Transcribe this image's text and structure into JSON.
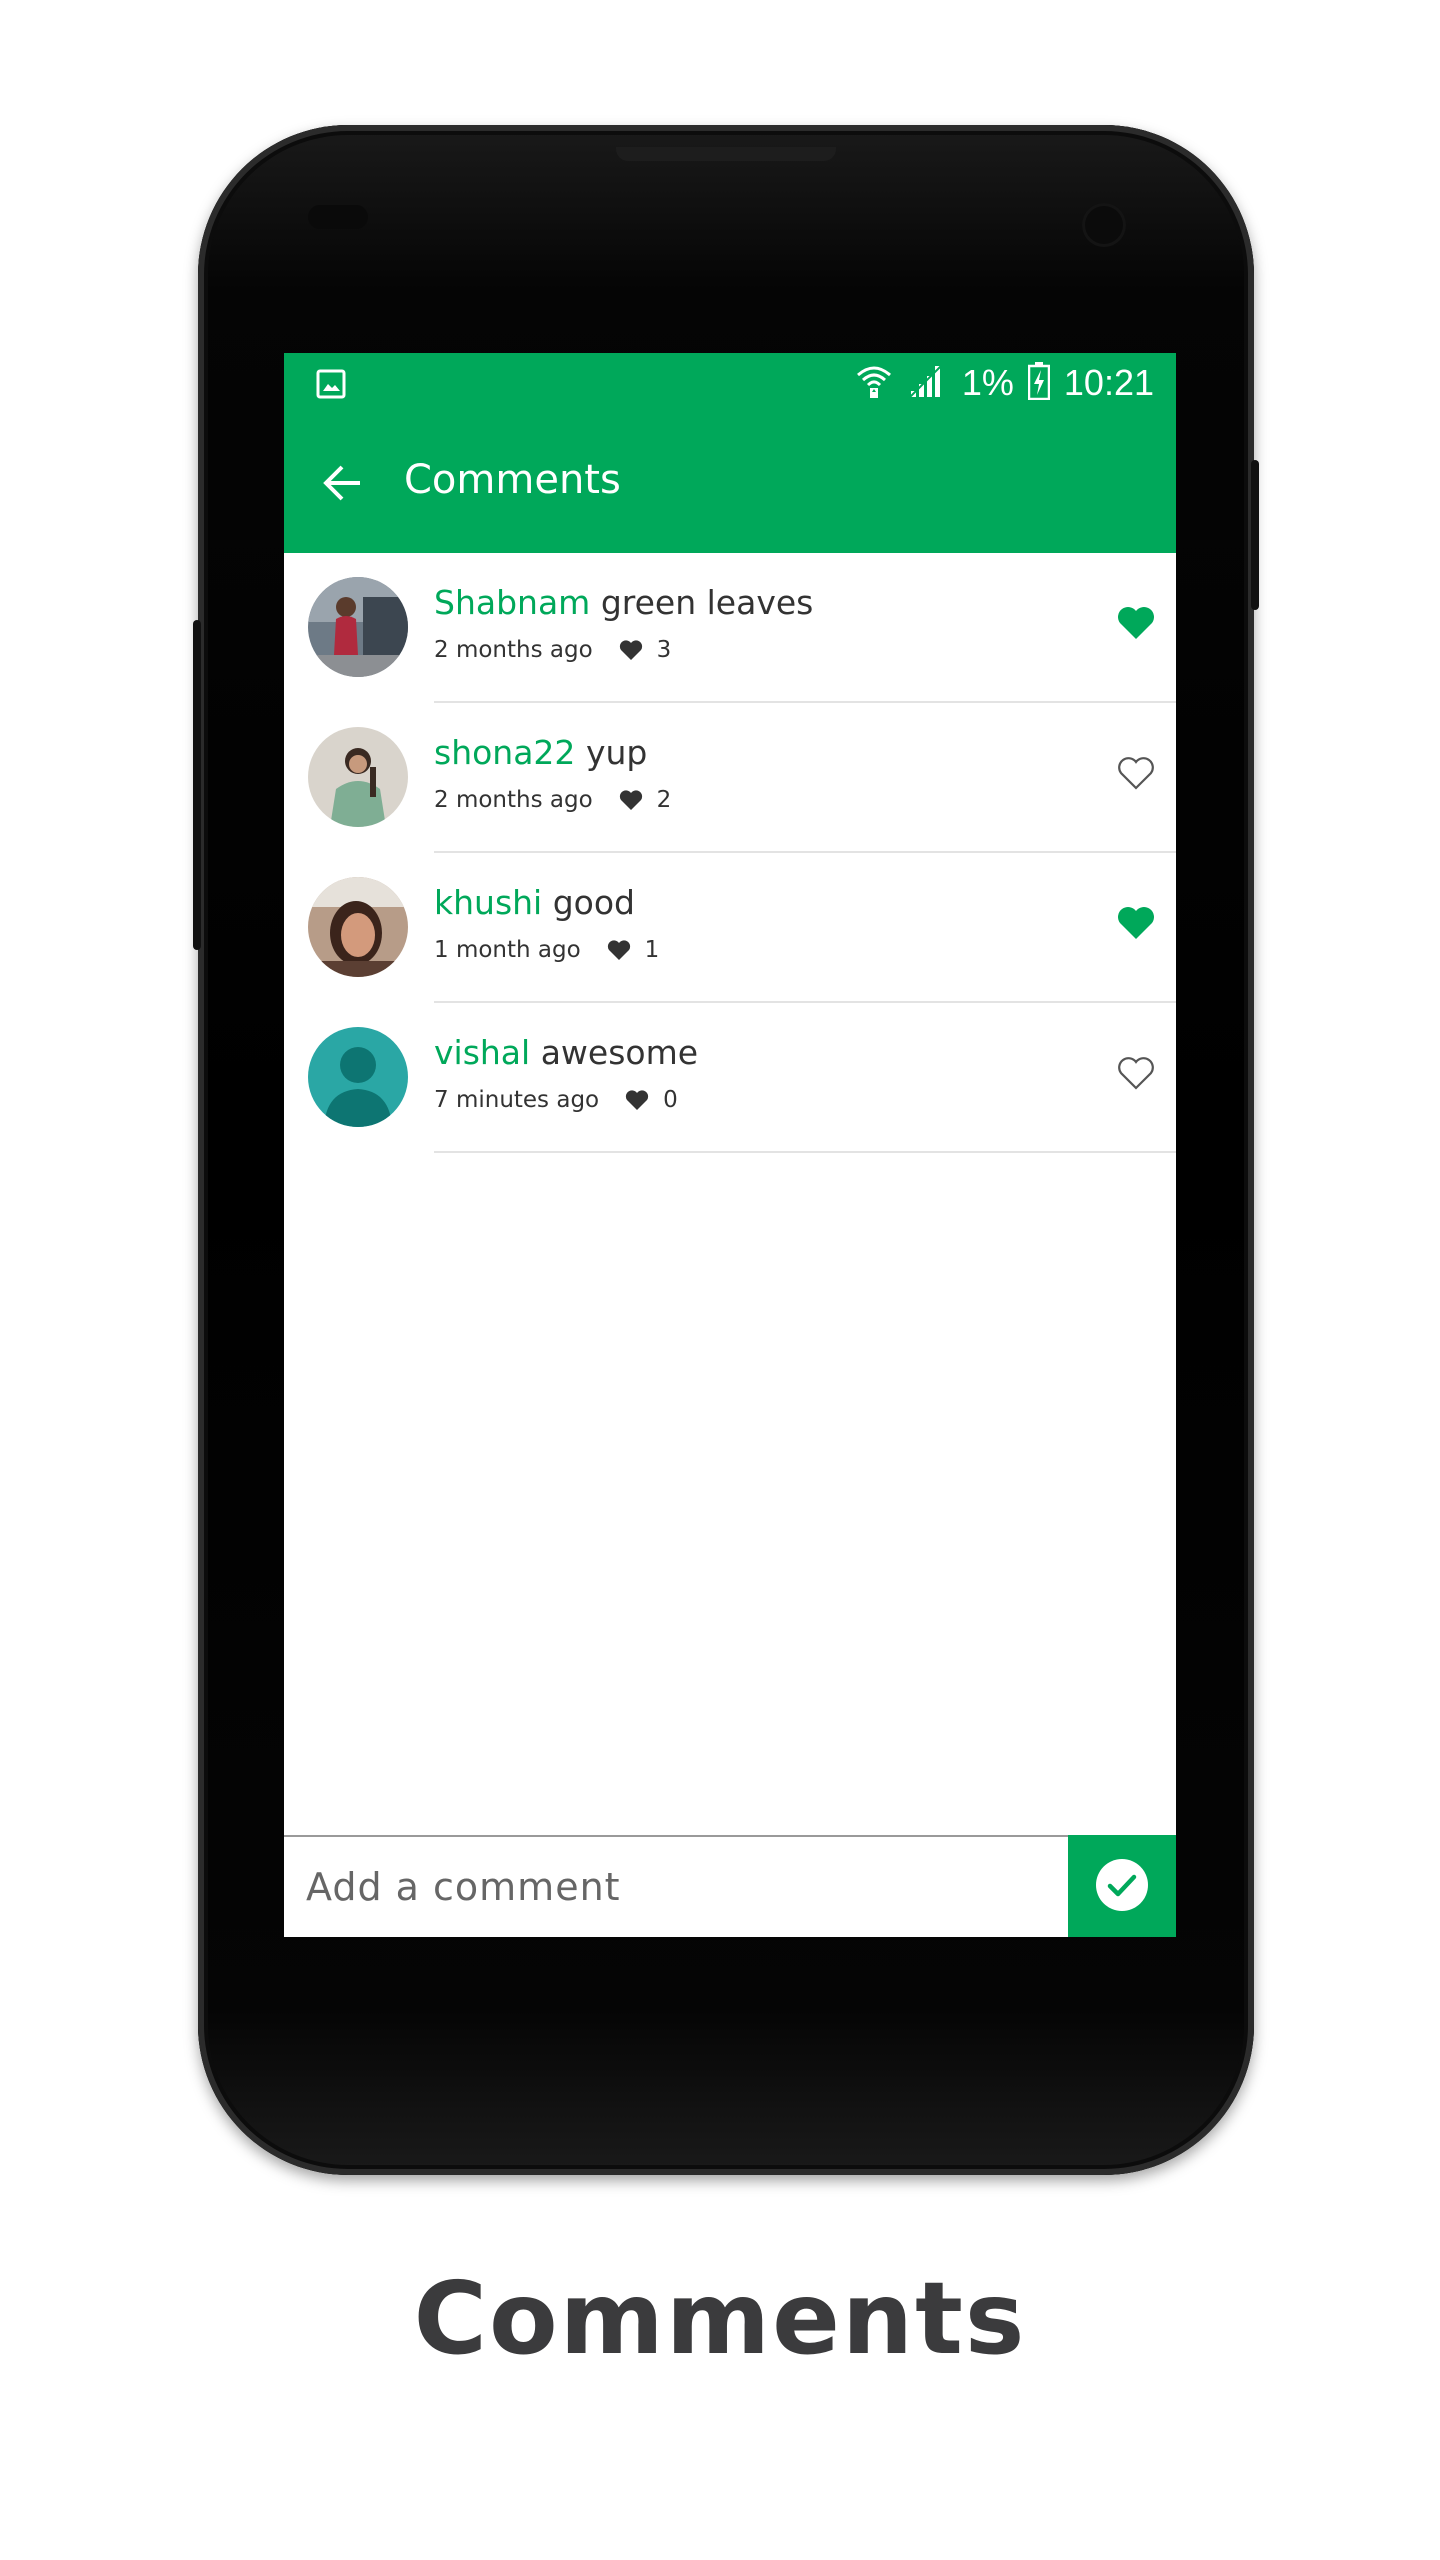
{
  "colors": {
    "accent": "#00a85a",
    "text": "#333333",
    "caption": "#3b3b3d"
  },
  "status_bar": {
    "battery": "1%",
    "time": "10:21",
    "icons": [
      "image-icon",
      "wifi-icon",
      "signal-icon",
      "battery-charging-icon"
    ]
  },
  "app_bar": {
    "title": "Comments",
    "back_icon": "arrow-left-icon"
  },
  "comments": [
    {
      "user": "Shabnam",
      "text": "green leaves",
      "time": "2 months ago",
      "likes": "3",
      "liked": true
    },
    {
      "user": "shona22",
      "text": "yup",
      "time": "2 months ago",
      "likes": "2",
      "liked": false
    },
    {
      "user": "khushi",
      "text": "good",
      "time": "1 month ago",
      "likes": "1",
      "liked": true
    },
    {
      "user": "vishal",
      "text": "awesome",
      "time": "7 minutes ago",
      "likes": "0",
      "liked": false
    }
  ],
  "composer": {
    "placeholder": "Add a comment",
    "send_icon": "check-circle-icon"
  },
  "caption": "Comments"
}
